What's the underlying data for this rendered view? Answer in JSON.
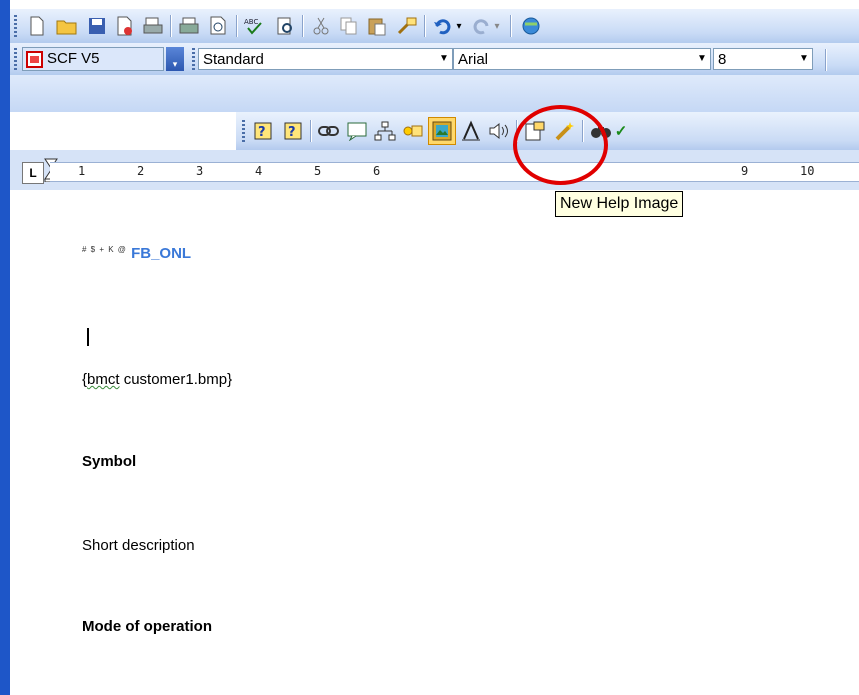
{
  "toolbar_standard": {
    "icons": [
      "new-document-icon",
      "open-folder-icon",
      "save-icon",
      "permission-icon",
      "print-preview-icon",
      "print-icon",
      "print-preview-zoom-icon",
      "spelling-icon",
      "research-icon",
      "cut-icon",
      "copy-icon",
      "paste-icon",
      "format-painter-icon",
      "undo-icon",
      "redo-icon",
      "hyperlink-icon"
    ]
  },
  "toolbar_format": {
    "scf_label": "SCF V5",
    "style_value": "Standard",
    "font_value": "Arial",
    "size_value": "8"
  },
  "toolbar_help": {
    "icons": [
      "context-help-icon",
      "what-is-this-icon",
      "link-icon",
      "comment-icon",
      "hierarchy-icon",
      "macro-icon",
      "new-help-image-icon",
      "font-icon",
      "sound-icon",
      "properties-icon",
      "wand-icon",
      "find-icon"
    ]
  },
  "ruler": {
    "tab_label": "L",
    "numbers": [
      "1",
      "2",
      "3",
      "4",
      "5",
      "6",
      "9",
      "10"
    ]
  },
  "tooltip": {
    "text": "New Help Image"
  },
  "document": {
    "footnote_marks": "# $ + K @",
    "topic_id": "FB_ONL",
    "image_ref_prefix": "{",
    "image_ref_word": "bmct",
    "image_ref_rest": " customer1.bmp}",
    "heading_symbol": "Symbol",
    "short_description": "Short description",
    "heading_mode": "Mode of operation"
  },
  "colors": {
    "frame_blue": "#1e56c8",
    "topic_blue": "#3a78d8",
    "highlight_red": "#e00000",
    "tooltip_bg": "#ffffe1"
  }
}
